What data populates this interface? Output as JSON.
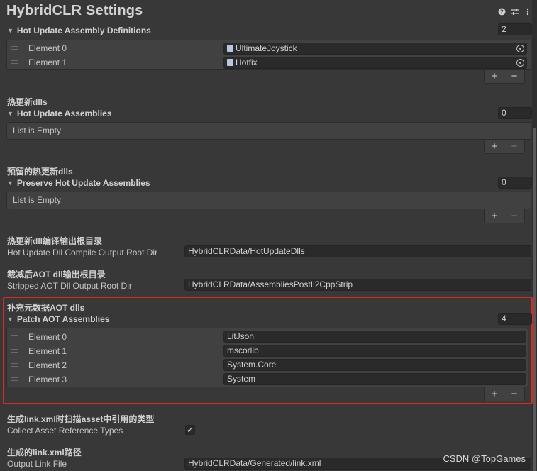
{
  "window": {
    "title": "HybridCLR Settings"
  },
  "toolbar_icons": [
    "help-icon",
    "sliders-icon",
    "more-icon"
  ],
  "hot_update_defs": {
    "fold_label": "Hot Update Assembly Definitions",
    "count": "2",
    "elements": [
      {
        "label": "Element 0",
        "value": "UltimateJoystick"
      },
      {
        "label": "Element 1",
        "value": "Hotfix"
      }
    ]
  },
  "hot_update_assemblies": {
    "header": "热更新dlls",
    "fold_label": "Hot Update Assemblies",
    "count": "0",
    "empty_text": "List is Empty"
  },
  "preserve_assemblies": {
    "header": "预留的热更新dlls",
    "fold_label": "Preserve Hot Update Assemblies",
    "count": "0",
    "empty_text": "List is Empty"
  },
  "compile_output": {
    "header": "热更新dll编译输出根目录",
    "label": "Hot Update Dll Compile Output Root Dir",
    "value": "HybridCLRData/HotUpdateDlls"
  },
  "stripped_output": {
    "header": "裁减后AOT dll输出根目录",
    "label": "Stripped AOT Dll Output Root Dir",
    "value": "HybridCLRData/AssembliesPostIl2CppStrip"
  },
  "patch_aot": {
    "header": "补充元数据AOT dlls",
    "fold_label": "Patch AOT Assemblies",
    "count": "4",
    "elements": [
      {
        "label": "Element 0",
        "value": "LitJson"
      },
      {
        "label": "Element 1",
        "value": "mscorlib"
      },
      {
        "label": "Element 2",
        "value": "System.Core"
      },
      {
        "label": "Element 3",
        "value": "System"
      }
    ]
  },
  "collect_refs": {
    "header": "生成link.xml时扫描asset中引用的类型",
    "label": "Collect Asset Reference Types",
    "checked": true,
    "check_glyph": "✓"
  },
  "link_file": {
    "header": "生成的link.xml路径",
    "label": "Output Link File",
    "value": "HybridCLRData/Generated/link.xml"
  },
  "buttons": {
    "plus": "+",
    "minus": "−"
  },
  "watermark": "CSDN @TopGames",
  "colors": {
    "highlight": "#e1261c",
    "background": "#383838",
    "field": "#2a2a2a"
  }
}
